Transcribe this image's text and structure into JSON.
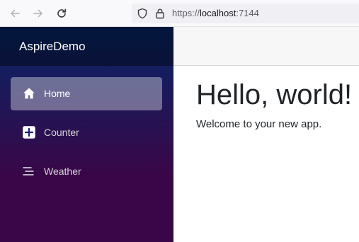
{
  "browser": {
    "back_icon": "arrow-left-icon",
    "forward_icon": "arrow-right-icon",
    "reload_icon": "reload-icon",
    "shield_icon": "shield-icon",
    "lock_icon": "lock-icon",
    "url": {
      "scheme": "https://",
      "host": "localhost",
      "port": ":7144"
    }
  },
  "sidebar": {
    "brand": "AspireDemo",
    "items": [
      {
        "label": "Home",
        "icon": "house-icon",
        "active": true
      },
      {
        "label": "Counter",
        "icon": "plus-square-icon",
        "active": false
      },
      {
        "label": "Weather",
        "icon": "list-icon",
        "active": false
      }
    ]
  },
  "main": {
    "title": "Hello, world!",
    "text": "Welcome to your new app."
  },
  "colors": {
    "sidebar_top": "#052767",
    "sidebar_bottom": "#3a0647",
    "active_item": "rgba(255,255,255,0.37)",
    "text": "#212529"
  }
}
